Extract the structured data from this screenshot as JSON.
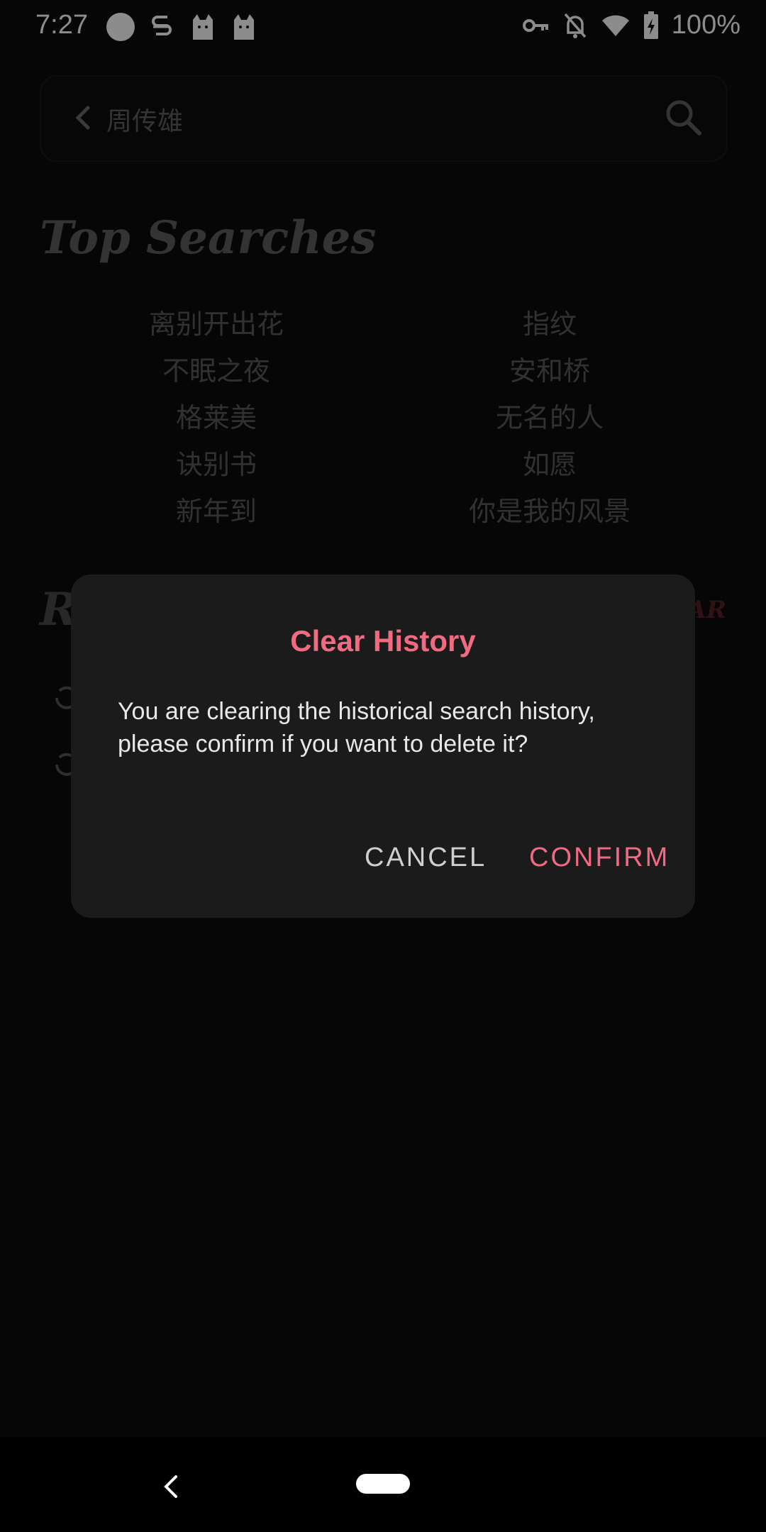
{
  "status_bar": {
    "time": "7:27",
    "battery": "100%"
  },
  "search": {
    "query": "周传雄"
  },
  "top_searches": {
    "title": "Top Searches",
    "left": [
      "离别开出花",
      "不眠之夜",
      "格莱美",
      "诀别书",
      "新年到"
    ],
    "right": [
      "指纹",
      "安和桥",
      "无名的人",
      "如愿",
      "你是我的风景"
    ]
  },
  "recent": {
    "title_partial": "R",
    "clear_partial": "AR"
  },
  "dialog": {
    "title": "Clear History",
    "message": "You are clearing the historical search history, please confirm if you want to delete it?",
    "cancel_label": "CANCEL",
    "confirm_label": "CONFIRM"
  },
  "colors": {
    "accent": "#f06b80",
    "background": "#0b0b0b",
    "dialog_bg": "#1b1b1c"
  }
}
